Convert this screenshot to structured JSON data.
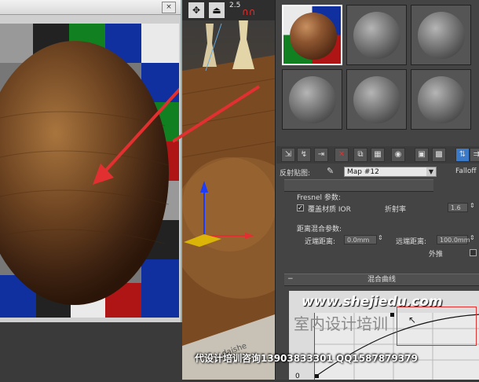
{
  "viewport": {
    "toolbar_number": "2.5",
    "newspaper_text": "daishe"
  },
  "render_window": {
    "close_label": "×"
  },
  "material_editor": {
    "slot_count": 6,
    "toolbar_buttons": [
      "get-material",
      "put-to-scene",
      "assign",
      "delete",
      "make-unique",
      "put-to-library",
      "material-effects",
      "show-map",
      "show-end-result",
      "go-to-parent",
      "go-forward"
    ],
    "reflection_map_label": "反射贴图:",
    "map_name": "Map #12",
    "map_type": "Falloff",
    "fresnel_title": "Fresnel 参数:",
    "override_ior_label": "覆盖材质 IOR",
    "override_ior_checked": true,
    "ior_label": "折射率",
    "ior_value": "1.6",
    "distance_title": "距离混合参数:",
    "near_label": "近端距离:",
    "near_value": "0.0mm",
    "far_label": "远端距离:",
    "far_value": "100.0mm",
    "extrapolate_label": "外推",
    "mix_curve_title": "混合曲线",
    "curve_axis_zero": "0"
  },
  "watermark": {
    "url": "www.shejiedu.com",
    "cn": "室内设计培训",
    "phone": "代设计培训咨询13903833301 QQ1587879379"
  },
  "colors": {
    "arrow": "#e23030",
    "gizmo_blue": "#1a3cff",
    "gizmo_yellow": "#e8c400",
    "checker": [
      "#1030a0",
      "#b01515",
      "#108020",
      "#eaeaea",
      "#222222",
      "#999999"
    ]
  }
}
